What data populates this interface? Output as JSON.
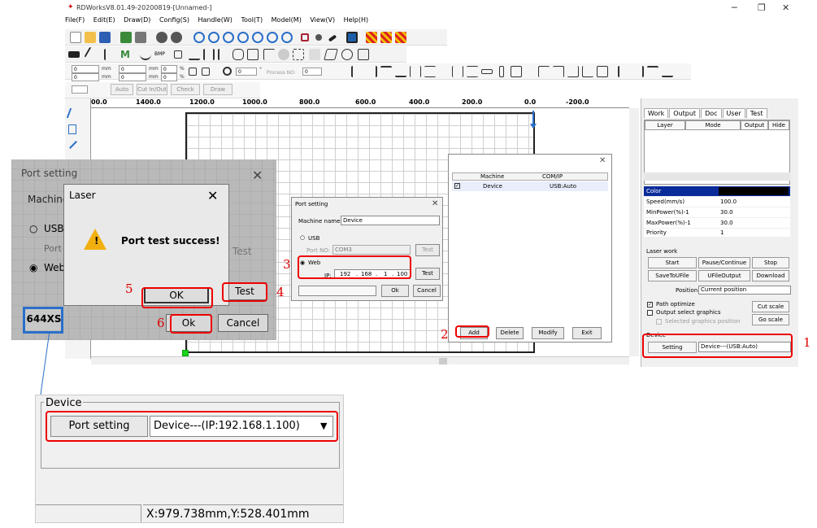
{
  "window": {
    "title": "RDWorksV8.01.49-20200819-[Unnamed-]",
    "minimize": "─",
    "restore": "❐",
    "close": "✕"
  },
  "menu": [
    "File(F)",
    "Edit(E)",
    "Draw(D)",
    "Config(S)",
    "Handle(W)",
    "Tool(T)",
    "Model(M)",
    "View(V)",
    "Help(H)"
  ],
  "toolbar3": {
    "x_value": "0",
    "y_value": "0",
    "w_value": "0",
    "h_value": "0",
    "pct1": "0",
    "pct2": "0",
    "mm": "mm",
    "pct": "%",
    "rotate_value": "0",
    "deg": "°",
    "process_no_label": "Process NO:",
    "process_no_value": "0"
  },
  "toolbar4": {
    "auto": "Auto",
    "cut_inout": "Cut In/Out",
    "check": "Check",
    "draw": "Draw"
  },
  "ruler": {
    "ticks": [
      "00.0",
      "1400.0",
      "1200.0",
      "1000.0",
      "800.0",
      "600.0",
      "400.0",
      "200.0",
      "0.0",
      "-200.0"
    ]
  },
  "right_panel": {
    "tabs": [
      "Work",
      "Output",
      "Doc",
      "User",
      "Test"
    ],
    "layer_cols": [
      "Layer",
      "Mode",
      "Output",
      "Hide"
    ],
    "props": [
      {
        "name": "Color",
        "value": ""
      },
      {
        "name": "Speed(mm/s)",
        "value": "100.0"
      },
      {
        "name": "MinPower(%)-1",
        "value": "30.0"
      },
      {
        "name": "MaxPower(%)-1",
        "value": "30.0"
      },
      {
        "name": "Priority",
        "value": "1"
      }
    ],
    "laser_work_title": "Laser work",
    "buttons": {
      "start": "Start",
      "pause": "Pause/Continue",
      "stop": "Stop",
      "save_to_ufile": "SaveToUFile",
      "ufile_output": "UFileOutput",
      "download": "Download"
    },
    "position_label": "Position:",
    "position_value": "Current position",
    "path_optimize": "Path optimize",
    "output_select": "Output select graphics",
    "selected_pos": "Selected graphics position",
    "cut_scale": "Cut scale",
    "go_scale": "Go scale",
    "device_title": "Device",
    "setting": "Setting",
    "device_value": "Device---(USB:Auto)"
  },
  "device_list_dialog": {
    "col_machine": "Machine",
    "col_comip": "COM/IP",
    "row_machine": "Device",
    "row_comip": "USB:Auto",
    "add": "Add",
    "delete": "Delete",
    "modify": "Modify",
    "exit": "Exit"
  },
  "port_dialog": {
    "title": "Port setting",
    "machine_name_label": "Machine name:",
    "machine_name_value": "Device",
    "usb_label": "USB",
    "port_no_label": "Port NO:",
    "port_no_value": "COM3",
    "test": "Test",
    "web_label": "Web",
    "ip_label": "IP:",
    "ip": [
      "192",
      "168",
      "1",
      "100"
    ],
    "test2": "Test",
    "ok": "Ok",
    "cancel": "Cancel"
  },
  "photo": {
    "port_setting_title": "Port setting",
    "machine_label": "Machine",
    "usb": "USB",
    "port": "Port",
    "web": "Web",
    "test_faded": "Test",
    "test": "Test",
    "ok_big": "Ok",
    "cancel": "Cancel",
    "machine_code": "644XS",
    "laser_title": "Laser",
    "message": "Port test success!",
    "ok": "OK"
  },
  "annotations": {
    "n1": "1",
    "n2": "2",
    "n3": "3",
    "n4": "4",
    "n5": "5",
    "n6": "6",
    "red": "#e00000",
    "blue": "#2a6fc9"
  },
  "zoom_panel": {
    "device_title": "Device",
    "port_setting": "Port setting",
    "device_value": "Device---(IP:192.168.1.100)",
    "status": "X:979.738mm,Y:528.401mm"
  }
}
